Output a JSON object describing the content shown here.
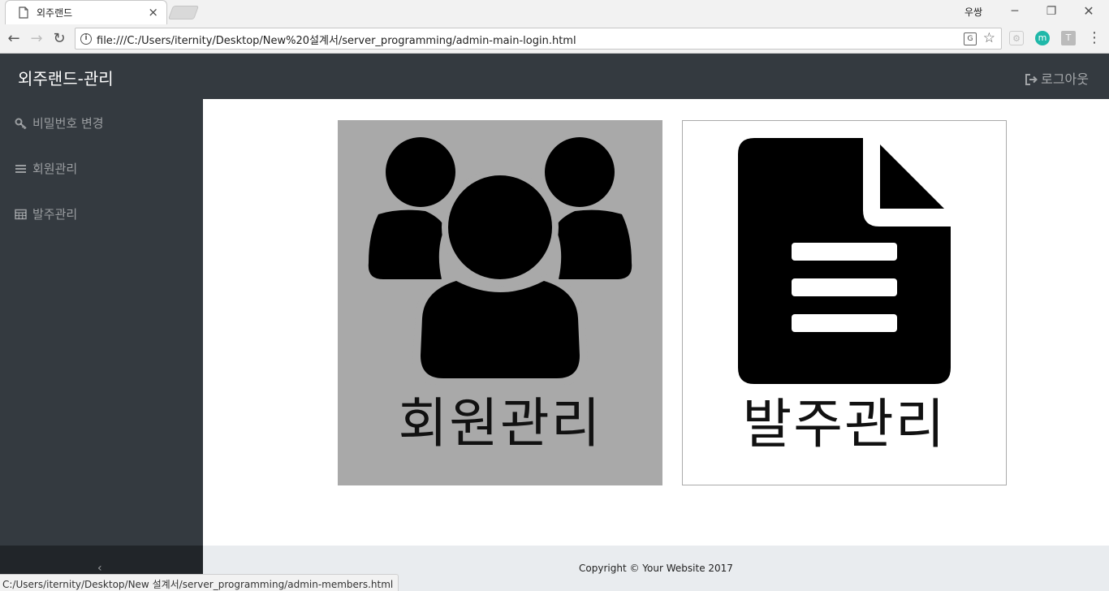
{
  "browser": {
    "tab_title": "외주랜드",
    "tab_close": "×",
    "window_user": "우쌍",
    "url": "file:///C:/Users/iternity/Desktop/New%20설계서/server_programming/admin-main-login.html",
    "status_url": "C:/Users/iternity/Desktop/New 설계서/server_programming/admin-members.html",
    "min_glyph": "─",
    "restore_glyph": "❐",
    "close_glyph": "✕",
    "back_glyph": "←",
    "forward_glyph": "→",
    "reload_glyph": "↻",
    "star_glyph": "☆",
    "menu_glyph": "⋮",
    "ext_icons": [
      "extension-icon",
      "m",
      "T"
    ]
  },
  "navbar": {
    "brand": "외주랜드-관리",
    "logout_label": "로그아웃"
  },
  "sidebar": {
    "items": [
      {
        "label": "비밀번호 변경",
        "icon": "key-icon"
      },
      {
        "label": "회원관리",
        "icon": "bars-icon"
      },
      {
        "label": "발주관리",
        "icon": "table-icon"
      }
    ],
    "toggler_glyph": "‹"
  },
  "main": {
    "cards": [
      {
        "label": "회원관리",
        "icon": "users-icon",
        "bg": "#a9a9a9"
      },
      {
        "label": "발주관리",
        "icon": "document-icon",
        "bg": "#ffffff"
      }
    ]
  },
  "footer": {
    "copyright": "Copyright © Your Website 2017"
  }
}
